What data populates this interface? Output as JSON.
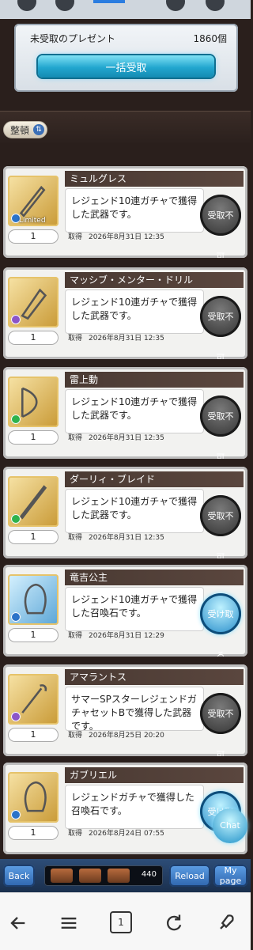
{
  "present": {
    "label": "未受取のプレゼント",
    "count": "1860個",
    "bulk_receive": "一括受取"
  },
  "sort": {
    "label": "整頓"
  },
  "items": [
    {
      "name": "ミュルグレス",
      "desc": "レジェンド10連ガチャで獲得した武器です。",
      "qty": "1",
      "acq_label": "取得",
      "date": "2026年8月31日 12:35",
      "status": "受取不可",
      "thumb_badge": "Limited",
      "thumb_style": "gold",
      "element_color": "#2b73c9",
      "icon": "sword-icon"
    },
    {
      "name": "マッシブ・メンター・ドリル",
      "desc": "レジェンド10連ガチャで獲得した武器です。",
      "qty": "1",
      "acq_label": "取得",
      "date": "2026年8月31日 12:35",
      "status": "受取不可",
      "thumb_badge": "",
      "thumb_style": "gold",
      "element_color": "#8b55c8",
      "icon": "drill-icon"
    },
    {
      "name": "雷上動",
      "desc": "レジェンド10連ガチャで獲得した武器です。",
      "qty": "1",
      "acq_label": "取得",
      "date": "2026年8月31日 12:35",
      "status": "受取不可",
      "thumb_badge": "",
      "thumb_style": "gold",
      "element_color": "#2fb24c",
      "icon": "bow-icon"
    },
    {
      "name": "ダーリィ・ブレイド",
      "desc": "レジェンド10連ガチャで獲得した武器です。",
      "qty": "1",
      "acq_label": "取得",
      "date": "2026年8月31日 12:35",
      "status": "受取不可",
      "thumb_badge": "",
      "thumb_style": "gold",
      "element_color": "#2fb24c",
      "icon": "spear-icon"
    },
    {
      "name": "竜吉公主",
      "desc": "レジェンド10連ガチャで獲得した召喚石です。",
      "qty": "1",
      "acq_label": "取得",
      "date": "2026年8月31日 12:29",
      "status": "受け取る",
      "thumb_badge": "",
      "thumb_style": "blue",
      "element_color": "#2b73c9",
      "icon": "summon-portrait-icon"
    },
    {
      "name": "アマラントス",
      "desc": "サマーSPスターレジェンドガチャセットBで獲得した武器です。",
      "qty": "1",
      "acq_label": "取得",
      "date": "2026年8月25日 20:20",
      "status": "受取不可",
      "thumb_badge": "",
      "thumb_style": "gold",
      "element_color": "#8b55c8",
      "icon": "staff-icon"
    },
    {
      "name": "ガブリエル",
      "desc": "レジェンドガチャで獲得した召喚石です。",
      "qty": "1",
      "acq_label": "取得",
      "date": "2026年8月24日 07:55",
      "status": "受け取",
      "thumb_badge": "",
      "thumb_style": "gold",
      "element_color": "#2b73c9",
      "icon": "summon-portrait-icon"
    }
  ],
  "chat": {
    "label": "Chat"
  },
  "bottom_nav": {
    "back": "Back",
    "reload": "Reload",
    "mypage": "My page",
    "tray_count": "440"
  },
  "browser": {
    "tab_count": "1",
    "icons": [
      "back-arrow-icon",
      "menu-icon",
      "tab-counter-icon",
      "refresh-icon",
      "rocket-icon"
    ]
  },
  "colors": {
    "accent_blue": "#2b7de0",
    "button_receive": "#1c86c7",
    "button_disabled": "#2f2f2f"
  }
}
